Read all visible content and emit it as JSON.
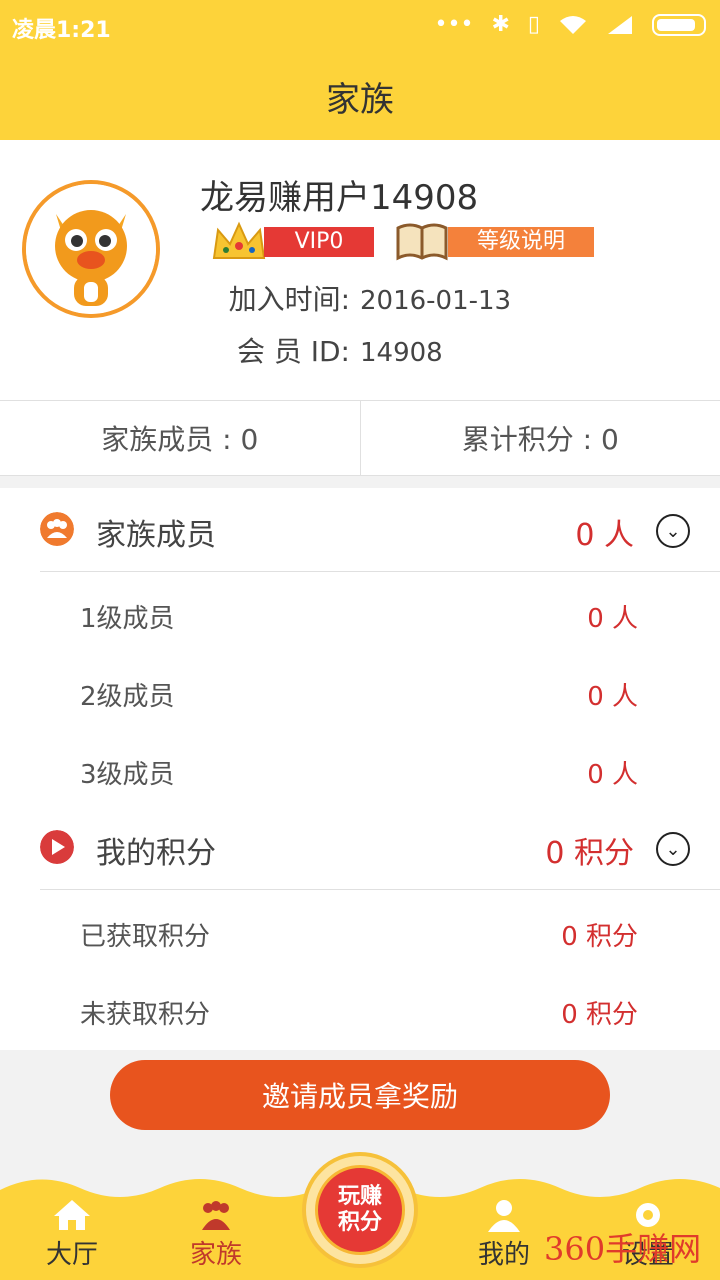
{
  "status": {
    "time": "凌晨1:21"
  },
  "header": {
    "title": "家族"
  },
  "profile": {
    "username": "龙易赚用户14908",
    "vip": "VIP0",
    "level_link": "等级说明",
    "join_label": "加入时间:",
    "join_date": "2016-01-13",
    "id_label": "会 员 ID:",
    "id_value": "14908"
  },
  "summary": {
    "members": "家族成员 : 0",
    "points": "累计积分 : 0"
  },
  "family": {
    "title": "家族成员",
    "total": "0 人",
    "rows": [
      {
        "label": "1级成员",
        "value": "0 人"
      },
      {
        "label": "2级成员",
        "value": "0 人"
      },
      {
        "label": "3级成员",
        "value": "0 人"
      }
    ]
  },
  "points": {
    "title": "我的积分",
    "total": "0 积分",
    "rows": [
      {
        "label": "已获取积分",
        "value": "0 积分"
      },
      {
        "label": "未获取积分",
        "value": "0 积分"
      }
    ]
  },
  "invite_button": "邀请成员拿奖励",
  "tabs": {
    "hall": "大厅",
    "family": "家族",
    "center_line1": "玩赚",
    "center_line2": "积分",
    "mine": "我的",
    "settings": "设置"
  },
  "watermark": "360手赚网",
  "colors": {
    "brand_yellow": "#fdd33a",
    "accent_red": "#d32f2f",
    "button_orange": "#e8541e"
  }
}
